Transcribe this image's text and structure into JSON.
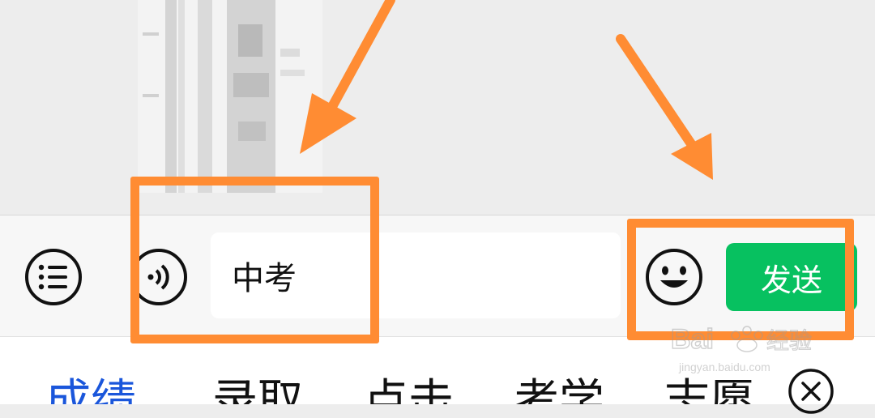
{
  "input": {
    "value": "中考",
    "send_label": "发送"
  },
  "icons": {
    "menu": "list-menu-icon",
    "voice": "voice-input-icon",
    "emoji": "emoji-icon",
    "close": "close-circle-icon"
  },
  "suggestions": {
    "items": [
      {
        "label": "成绩",
        "active": true
      },
      {
        "label": "录取",
        "active": false
      },
      {
        "label": "点击",
        "active": false
      },
      {
        "label": "考学",
        "active": false
      },
      {
        "label": "志愿",
        "active": false
      }
    ]
  },
  "annotations": {
    "highlight_color": "#ff8c33"
  },
  "watermark": {
    "brand": "Baidu经验",
    "url": "jingyan.baidu.com"
  },
  "colors": {
    "send_button": "#07c160",
    "active_suggestion": "#1a56db"
  }
}
